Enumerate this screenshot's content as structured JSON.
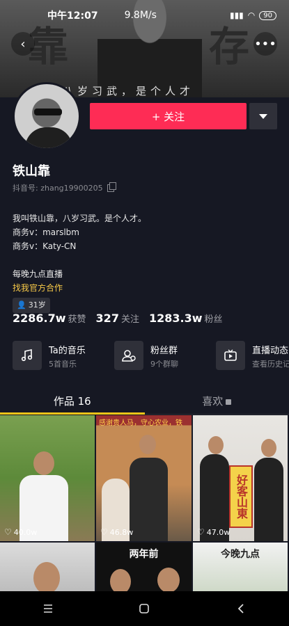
{
  "status_bar": {
    "time": "中午12:07",
    "speed": "9.8M/s",
    "battery": "90"
  },
  "banner": {
    "char_left": "靠",
    "char_right": "存",
    "caption": "八岁习武，是个人才"
  },
  "profile": {
    "follow_label": "+ 关注",
    "name": "铁山靠",
    "douyin_id": "抖音号: zhang19900205",
    "bio": [
      "我叫铁山靠，八岁习武。是个人才。",
      "商务v：marslbm",
      "商务v：Katy-CN"
    ],
    "bio_extra": "每晚九点直播",
    "bio_link": "找我官方合作",
    "age_tag": "31岁"
  },
  "stats": [
    {
      "value": "2286.7w",
      "label": "获赞"
    },
    {
      "value": "327",
      "label": "关注"
    },
    {
      "value": "1283.3w",
      "label": "粉丝"
    }
  ],
  "features": [
    {
      "title": "Ta的音乐",
      "subtitle": "5首音乐",
      "icon": "music-note-icon"
    },
    {
      "title": "粉丝群",
      "subtitle": "9个群聊",
      "icon": "fan-group-icon"
    },
    {
      "title": "直播动态",
      "subtitle": "查看历史记录",
      "icon": "live-tv-icon"
    }
  ],
  "tabs": [
    {
      "label": "作品 16",
      "active": true
    },
    {
      "label": "喜欢",
      "locked": true
    }
  ],
  "videos": [
    {
      "likes": "40.0w"
    },
    {
      "likes": "46.8w",
      "top_text": "感谢贵人马，守心农业，铁"
    },
    {
      "likes": "47.0w",
      "sign_text": "好客山東"
    },
    {
      "likes": ""
    },
    {
      "likes": "",
      "top_text": "两年前"
    },
    {
      "likes": "",
      "top_text": "今晚九点"
    }
  ]
}
